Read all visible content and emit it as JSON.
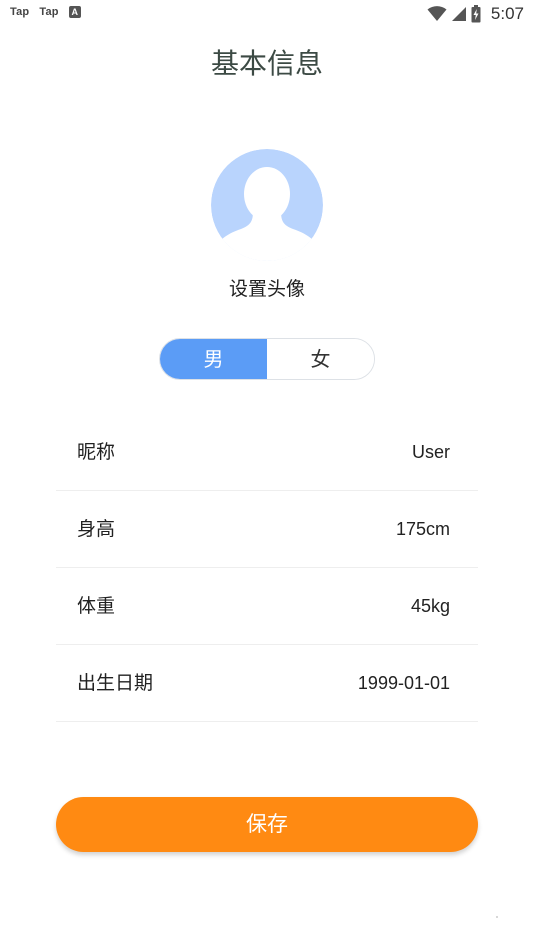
{
  "status_bar": {
    "app1": "Tap",
    "app2": "Tap",
    "time": "5:07"
  },
  "page": {
    "title": "基本信息"
  },
  "avatar": {
    "label": "设置头像",
    "color": "#b9d4fd"
  },
  "gender": {
    "male": "男",
    "female": "女",
    "selected": "男",
    "active_color": "#5b9cf6"
  },
  "info": {
    "rows": [
      {
        "label": "昵称",
        "value": "User"
      },
      {
        "label": "身高",
        "value": "175cm"
      },
      {
        "label": "体重",
        "value": "45kg"
      },
      {
        "label": "出生日期",
        "value": "1999-01-01"
      }
    ]
  },
  "actions": {
    "save_label": "保存",
    "save_color": "#ff8a12"
  },
  "icons": {
    "status_left": [
      "tap-app-icon",
      "tap-app-icon",
      "a-notification-icon"
    ],
    "status_right": [
      "wifi-icon",
      "signal-icon",
      "battery-charging-icon"
    ],
    "avatar": "person-silhouette-icon"
  }
}
